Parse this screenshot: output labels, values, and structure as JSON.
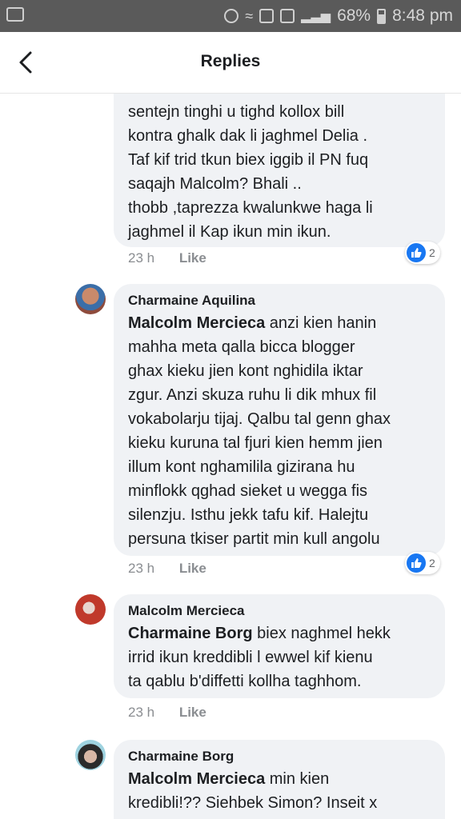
{
  "status_bar": {
    "battery": "68%",
    "time": "8:48 pm"
  },
  "header": {
    "title": "Replies"
  },
  "replies": [
    {
      "author": "",
      "mention": "",
      "text": "sentejn tinghi u tighd kollox bill\nkontra ghalk dak li jaghmel Delia .\nTaf kif trid tkun biex iggib il PN fuq\nsaqajh Malcolm? Bhali ..\nthobb ,taprezza kwalunkwe haga li\njaghmel il Kap ikun min ikun.",
      "time": "23 h",
      "like_label": "Like",
      "reaction_count": "2"
    },
    {
      "author": "Charmaine Aquilina",
      "mention": "Malcolm Mercieca",
      "text": " anzi kien hanin\nmahha meta qalla bicca blogger\nghax kieku jien kont nghidila iktar\nzgur. Anzi skuza ruhu li dik mhux fil\nvokabolarju tijaj. Qalbu tal genn ghax\nkieku kuruna tal fjuri kien hemm jien\nillum kont nghamilila gizirana hu\nminflokk qghad sieket u wegga fis\nsilenzju. Isthu jekk tafu kif. Halejtu\npersuna tkiser partit min kull angolu",
      "time": "23 h",
      "like_label": "Like",
      "reaction_count": "2"
    },
    {
      "author": "Malcolm Mercieca",
      "mention": "Charmaine Borg",
      "text": " biex naghmel hekk\nirrid ikun kreddibli l ewwel kif kienu\nta qablu b'diffetti kollha taghhom.",
      "time": "23 h",
      "like_label": "Like",
      "reaction_count": ""
    },
    {
      "author": "Charmaine Borg",
      "mention": "Malcolm Mercieca",
      "text": " min kien\nkredibli!?? Siehbek Simon? Inseit x",
      "time": "",
      "like_label": "",
      "reaction_count": ""
    }
  ]
}
